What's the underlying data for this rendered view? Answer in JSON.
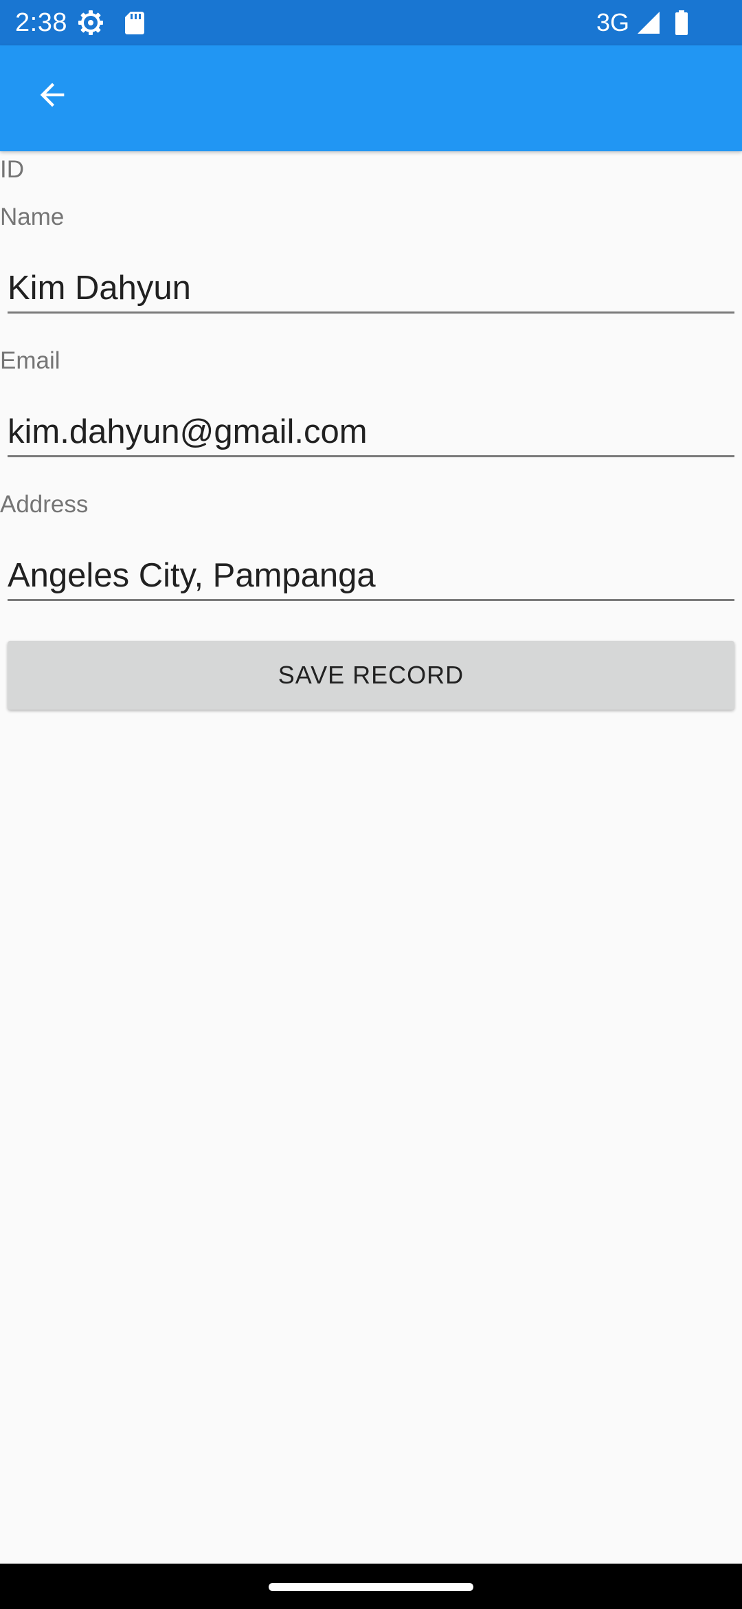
{
  "status_bar": {
    "time": "2:38",
    "network": "3G",
    "icons": [
      "settings-gear-icon",
      "sd-card-icon",
      "signal-icon",
      "battery-icon"
    ]
  },
  "app_bar": {
    "background_color": "#2196f3",
    "back_icon": "arrow-left-icon"
  },
  "form": {
    "id_label": "ID",
    "name_label": "Name",
    "name_value": "Kim Dahyun",
    "email_label": "Email",
    "email_value": "kim.dahyun@gmail.com",
    "address_label": "Address",
    "address_value": "Angeles City, Pampanga",
    "save_label": "SAVE RECORD"
  },
  "colors": {
    "status_bar": "#1976d2",
    "app_bar": "#2196f3",
    "background": "#fafafa",
    "button": "#d6d7d7"
  }
}
